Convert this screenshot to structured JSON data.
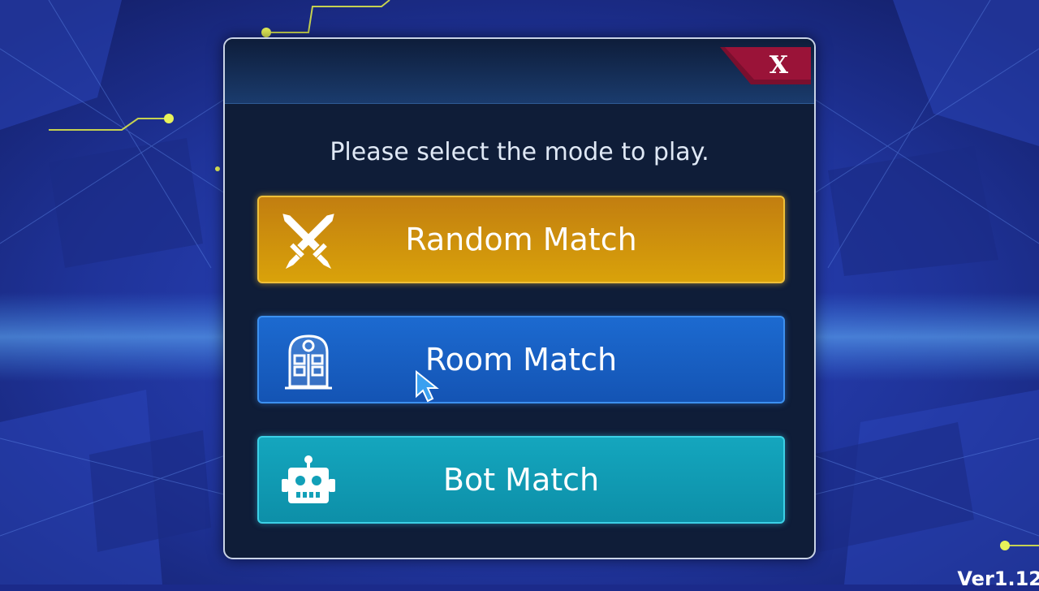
{
  "dialog": {
    "prompt": "Please select the mode to play.",
    "close_label": "X"
  },
  "modes": [
    {
      "label": "Random Match",
      "icon": "crossed-swords-icon",
      "color": "#d19010"
    },
    {
      "label": "Room Match",
      "icon": "door-icon",
      "color": "#1a62c8"
    },
    {
      "label": "Bot Match",
      "icon": "robot-icon",
      "color": "#12a0b8"
    }
  ],
  "version": "Ver1.12"
}
